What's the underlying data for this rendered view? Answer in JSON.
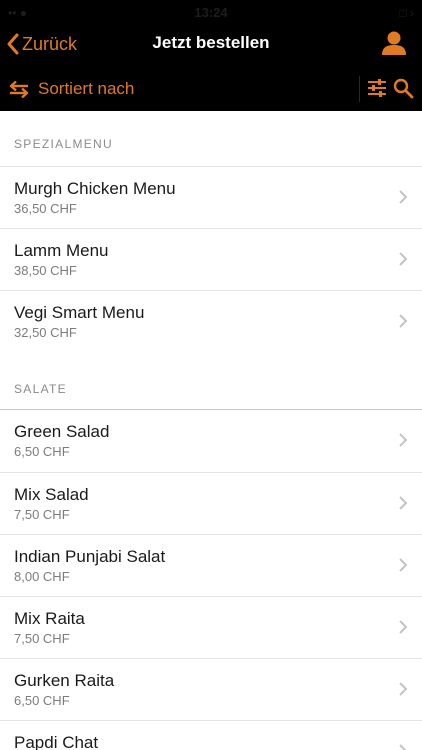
{
  "statusbar": {
    "time": "13:24",
    "left": "•• ●",
    "right": "□ ›"
  },
  "navbar": {
    "back_label": "Zurück",
    "title": "Jetzt bestellen"
  },
  "toolbar": {
    "sort_label": "Sortiert nach"
  },
  "colors": {
    "accent": "#e07b25",
    "header_bg": "#000000",
    "text": "#1a1a1a",
    "secondary_text": "#7c7c7c"
  },
  "icons": {
    "back": "chevron-left-icon",
    "profile": "person-icon",
    "sort": "swap-arrows-icon",
    "filter": "sliders-icon",
    "search": "search-icon",
    "row": "chevron-right-icon"
  },
  "sections": [
    {
      "title": "SPEZIALMENU",
      "items": [
        {
          "name": "Murgh Chicken Menu",
          "price": "36,50 CHF"
        },
        {
          "name": "Lamm Menu",
          "price": "38,50 CHF"
        },
        {
          "name": "Vegi Smart Menu",
          "price": "32,50 CHF"
        }
      ]
    },
    {
      "title": "SALATE",
      "items": [
        {
          "name": "Green Salad",
          "price": "6,50 CHF"
        },
        {
          "name": "Mix Salad",
          "price": "7,50 CHF"
        },
        {
          "name": "Indian Punjabi Salat",
          "price": "8,00 CHF"
        },
        {
          "name": "Mix Raita",
          "price": "7,50 CHF"
        },
        {
          "name": "Gurken Raita",
          "price": "6,50 CHF"
        },
        {
          "name": "Papdi Chat",
          "price": ""
        }
      ]
    }
  ]
}
